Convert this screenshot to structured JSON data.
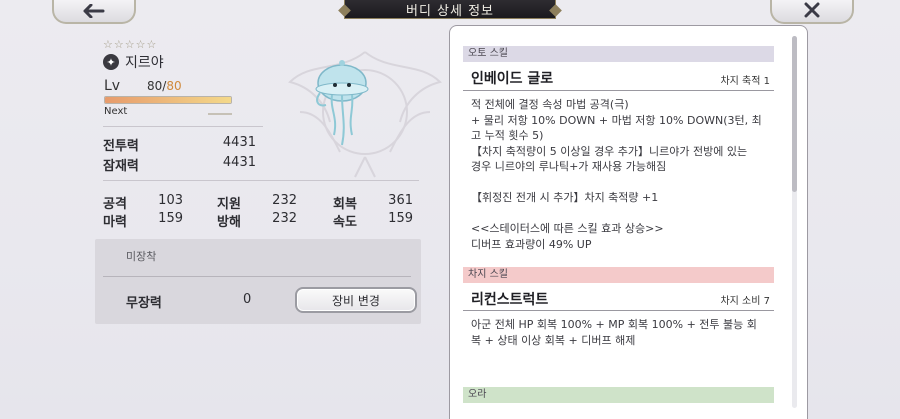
{
  "header": {
    "back_icon": "back-arrow-icon",
    "title": "버디 상세 정보",
    "close_icon": "close-x-icon"
  },
  "character": {
    "stars": "☆☆☆☆☆",
    "element_icon": "dark-element-icon",
    "name": "지르야",
    "lv_label": "Lv",
    "level": "80",
    "level_sep": "/",
    "max_level": "80",
    "exp_fraction": 1.0,
    "next_label": "Next"
  },
  "power": {
    "combat_label": "전투력",
    "combat_value": "4431",
    "potential_label": "잠재력",
    "potential_value": "4431"
  },
  "stats": {
    "atk_label": "공격",
    "atk_value": "103",
    "support_label": "지원",
    "support_value": "232",
    "heal_label": "회복",
    "heal_value": "361",
    "magic_label": "마력",
    "magic_value": "159",
    "hinder_label": "방해",
    "hinder_value": "232",
    "speed_label": "속도",
    "speed_value": "159"
  },
  "equipment": {
    "status": "미장착",
    "power_label": "무장력",
    "power_value": "0",
    "change_button": "장비 변경"
  },
  "skills": {
    "auto": {
      "section": "오토 스킬",
      "name": "인베이드 글로",
      "meta": "차지 축적 1",
      "lines": [
        "적 전체에 결정 속성 마법 공격(극)",
        "+ 물리 저항 10% DOWN + 마법 저항 10% DOWN(3턴, 최",
        "고 누적 횟수 5)",
        "【차지 축적량이 5 이상일 경우 추가】니르야가 전방에 있는",
        "경우 니르야의 루나틱+가 재사용 가능해짐",
        "",
        "【휘정진 전개 시 추가】차지 축적량 +1",
        "",
        "<<스테이터스에 따른 스킬 효과 상승>>",
        "디버프 효과량이 49% UP"
      ]
    },
    "charge": {
      "section": "차지 스킬",
      "name": "리컨스트럭트",
      "meta": "차지 소비 7",
      "lines": [
        "아군 전체 HP 회복 100% + MP 회복 100% + 전투 불능 회",
        "복 + 상태 이상 회복 + 디버프 해제"
      ]
    },
    "aura": {
      "section": "오라"
    }
  }
}
